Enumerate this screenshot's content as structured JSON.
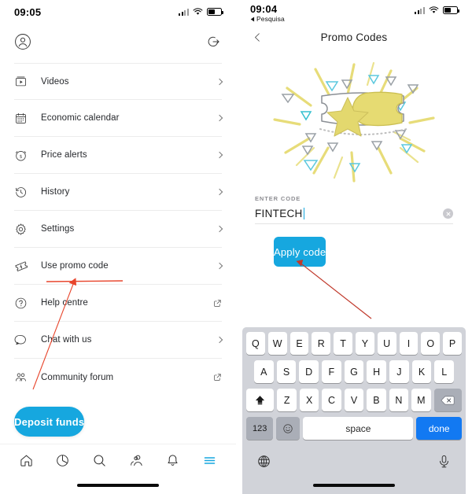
{
  "left_phone": {
    "status_bar": {
      "time": "09:05",
      "signal_icon": "cellular-signal-icon",
      "wifi_icon": "wifi-icon",
      "battery_icon": "battery-icon"
    },
    "account_row": {
      "avatar_icon": "account-avatar-icon",
      "logout_icon": "logout-icon"
    },
    "menu_items": [
      {
        "label": "Videos",
        "icon": "video-icon",
        "tail": "chevron"
      },
      {
        "label": "Economic calendar",
        "icon": "calendar-icon",
        "tail": "chevron"
      },
      {
        "label": "Price alerts",
        "icon": "price-alert-icon",
        "tail": "chevron"
      },
      {
        "label": "History",
        "icon": "history-clock-icon",
        "tail": "chevron"
      },
      {
        "label": "Settings",
        "icon": "gear-icon",
        "tail": "chevron"
      },
      {
        "label": "Use promo code",
        "icon": "ticket-icon",
        "tail": "chevron"
      },
      {
        "label": "Help centre",
        "icon": "question-circle-icon",
        "tail": "external"
      },
      {
        "label": "Chat with us",
        "icon": "chat-bubble-icon",
        "tail": "chevron"
      },
      {
        "label": "Community forum",
        "icon": "community-people-icon",
        "tail": "external"
      }
    ],
    "deposit_button": "Deposit funds",
    "tab_bar": [
      {
        "icon": "home-icon",
        "active": false
      },
      {
        "icon": "pie-chart-icon",
        "active": false
      },
      {
        "icon": "search-icon",
        "active": false
      },
      {
        "icon": "people-icon",
        "active": false
      },
      {
        "icon": "bell-icon",
        "active": false
      },
      {
        "icon": "hamburger-menu-icon",
        "active": true
      }
    ]
  },
  "right_phone": {
    "status_bar": {
      "time": "09:04",
      "back_app": "Pesquisa",
      "back_arrow_icon": "back-triangle-icon",
      "signal_icon": "cellular-signal-icon",
      "wifi_icon": "wifi-icon",
      "battery_icon": "battery-icon"
    },
    "nav": {
      "back_icon": "chevron-left-icon",
      "title": "Promo Codes"
    },
    "hero_illustration": "promo-ticket-star-illustration",
    "form": {
      "label": "ENTER CODE",
      "value": "FINTECH",
      "placeholder": "Enter code",
      "clear_icon": "clear-circle-icon",
      "apply_button": "Apply code"
    },
    "keyboard": {
      "row1": [
        "Q",
        "W",
        "E",
        "R",
        "T",
        "Y",
        "U",
        "I",
        "O",
        "P"
      ],
      "row2": [
        "A",
        "S",
        "D",
        "F",
        "G",
        "H",
        "J",
        "K",
        "L"
      ],
      "row3": [
        "Z",
        "X",
        "C",
        "V",
        "B",
        "N",
        "M"
      ],
      "shift_icon": "shift-up-icon",
      "backspace_icon": "backspace-delete-icon",
      "numbers_key": "123",
      "emoji_key": "emoji-smiley-icon",
      "space_key": "space",
      "done_key": "done",
      "globe_icon": "globe-language-icon",
      "mic_icon": "microphone-icon"
    }
  },
  "annotations": {
    "accent_color": "#E8452C",
    "underline_target": "Use promo code",
    "arrow_left": "arrow-pointing-to-use-promo-code",
    "arrow_right": "arrow-pointing-to-enter-code-field"
  },
  "theme": {
    "brand_blue": "#16A7DF",
    "keyboard_blue": "#1279F2",
    "ticket_yellow": "#E8DC74",
    "ticket_teal": "#5BC8DE"
  }
}
